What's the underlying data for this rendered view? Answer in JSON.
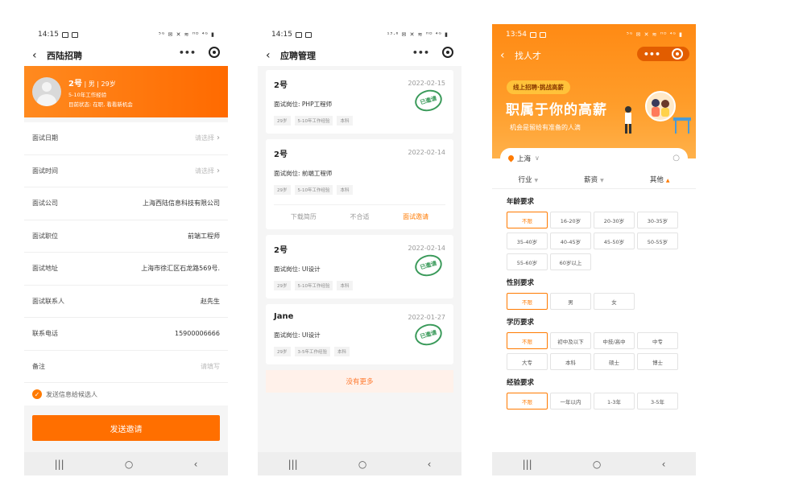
{
  "phone1": {
    "status": {
      "time": "14:15",
      "icons": "⁵ᴳ ✉ ✕ ≋ ᴴᴰ ⁴ᴳ ▮"
    },
    "nav": {
      "back": "‹",
      "title": "西陆招聘",
      "more": "•••"
    },
    "profile": {
      "name": "2号",
      "gender": "男",
      "age": "29岁",
      "experience": "5-10年工作经验",
      "status": "目前状态: 在职, 看看新机会"
    },
    "form": [
      {
        "label": "面试日期",
        "value": "请选择",
        "placeholder": true,
        "chevron": true
      },
      {
        "label": "面试时间",
        "value": "请选择",
        "placeholder": true,
        "chevron": true
      },
      {
        "label": "面试公司",
        "value": "上海西陆信息科技有限公司",
        "placeholder": false,
        "chevron": false
      },
      {
        "label": "面试职位",
        "value": "前端工程师",
        "placeholder": false,
        "chevron": false
      },
      {
        "label": "面试地址",
        "value": "上海市徐汇区石龙路569号.",
        "placeholder": false,
        "chevron": false
      },
      {
        "label": "面试联系人",
        "value": "赵先生",
        "placeholder": false,
        "chevron": false
      },
      {
        "label": "联系电话",
        "value": "15900006666",
        "placeholder": false,
        "chevron": false
      },
      {
        "label": "备注",
        "value": "请填写",
        "placeholder": true,
        "chevron": false
      }
    ],
    "agree_label": "发送信息给候选人",
    "send_label": "发送邀请"
  },
  "phone2": {
    "status": {
      "time": "14:15",
      "icons": "¹³·⁶ ✉ ✕ ≋ ᴴᴰ ⁴ᴳ ▮"
    },
    "nav": {
      "back": "‹",
      "title": "应聘管理",
      "more": "•••"
    },
    "cards": [
      {
        "name": "2号",
        "date": "2022-02-15",
        "position": "面试岗位: PHP工程师",
        "tags": [
          "29岁",
          "5-10年工作经验",
          "本科"
        ],
        "stamp": "已邀请",
        "actions": []
      },
      {
        "name": "2号",
        "date": "2022-02-14",
        "position": "面试岗位: 前端工程师",
        "tags": [
          "29岁",
          "5-10年工作经验",
          "本科"
        ],
        "stamp": "",
        "actions": [
          "下载简历",
          "不合适",
          "面试邀请"
        ]
      },
      {
        "name": "2号",
        "date": "2022-02-14",
        "position": "面试岗位: UI设计",
        "tags": [
          "29岁",
          "5-10年工作经验",
          "本科"
        ],
        "stamp": "已邀请",
        "actions": []
      },
      {
        "name": "Jane",
        "date": "2022-01-27",
        "position": "面试岗位: UI设计",
        "tags": [
          "29岁",
          "3-5年工作经验",
          "本科"
        ],
        "stamp": "已邀请",
        "actions": []
      }
    ],
    "no_more": "没有更多"
  },
  "phone3": {
    "status": {
      "time": "13:54",
      "icons": "⁵ᴳ ✉ ✕ ≋ ᴴᴰ ⁴ᴳ ▮"
    },
    "nav": {
      "back": "‹",
      "title": "找人才",
      "more": "•••"
    },
    "banner": {
      "pill": "线上招聘·挑战高薪",
      "slogan": "职属于你的高薪",
      "sub": "机会是留给有准备的人滴"
    },
    "city": "上海",
    "filters": [
      "行业",
      "薪资",
      "其他"
    ],
    "sections": [
      {
        "title": "年龄要求",
        "options": [
          "不限",
          "16-20岁",
          "20-30岁",
          "30-35岁",
          "35-40岁",
          "40-45岁",
          "45-50岁",
          "50-55岁",
          "55-60岁",
          "60岁以上"
        ]
      },
      {
        "title": "性别要求",
        "options": [
          "不限",
          "男",
          "女"
        ]
      },
      {
        "title": "学历要求",
        "options": [
          "不限",
          "初中及以下",
          "中技/高中",
          "中专",
          "大专",
          "本科",
          "硕士",
          "博士"
        ]
      },
      {
        "title": "经验要求",
        "options": [
          "不限",
          "一年以内",
          "1-3年",
          "3-5年"
        ]
      }
    ]
  },
  "bottom_nav": [
    "|||",
    "○",
    "‹"
  ],
  "colors": {
    "accent": "#ff7a00",
    "stamp": "#3a9a5a"
  }
}
